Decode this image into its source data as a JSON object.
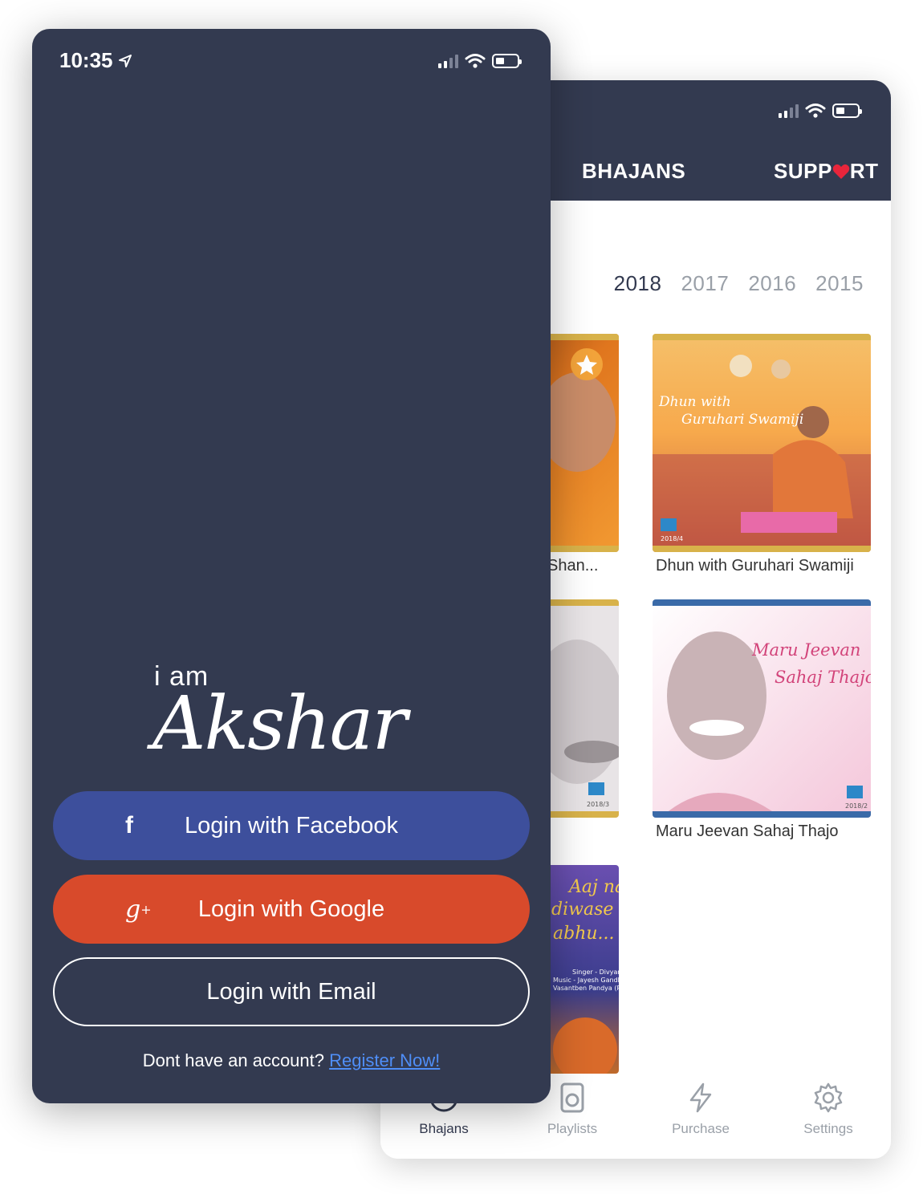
{
  "login_screen": {
    "status_time": "10:35",
    "logo_prefix": "i am",
    "logo_name": "Akshar",
    "facebook_label": "Login with Facebook",
    "google_label": "Login with Google",
    "email_label": "Login with Email",
    "register_prompt": "Dont have an account?",
    "register_link": "Register Now!"
  },
  "bhajans_screen": {
    "header_title": "BHAJANS",
    "support_label_pre": "SUPP",
    "support_label_post": "RT",
    "years": [
      "2018",
      "2017",
      "2016",
      "2015"
    ],
    "selected_year": "2018",
    "albums": [
      {
        "title": "Shan...",
        "tag": ""
      },
      {
        "title": "Dhun with Guruhari Swamiji",
        "art_lines": [
          "Dhun with",
          "Guruhari Swamiji"
        ],
        "tag": "2018/4"
      },
      {
        "title": "",
        "tag": "2018/3"
      },
      {
        "title": "Maru Jeevan Sahaj Thajo",
        "art_lines": [
          "Maru Jeevan",
          "Sahaj Thajo"
        ],
        "tag": "2018/2"
      },
      {
        "title": "",
        "art_lines": [
          "Aaj na",
          "diwase",
          "abhu..."
        ],
        "credits": [
          "Singer - Divyang Ray",
          "Music - Jayesh Gandhi",
          "Vasantben Pandya (Rajkot)"
        ],
        "tag": ""
      }
    ],
    "tabs": [
      {
        "label": "Bhajans",
        "icon": "disc-icon",
        "active": true
      },
      {
        "label": "Playlists",
        "icon": "playlist-icon",
        "active": false
      },
      {
        "label": "Purchase",
        "icon": "lightning-icon",
        "active": false
      },
      {
        "label": "Settings",
        "icon": "gear-icon",
        "active": false
      }
    ]
  },
  "colors": {
    "navy": "#333a50",
    "facebook": "#3d4f9c",
    "google": "#d84a2b",
    "link": "#4f8ef7",
    "heart": "#e8253b",
    "inactive": "#9aa0a8"
  }
}
